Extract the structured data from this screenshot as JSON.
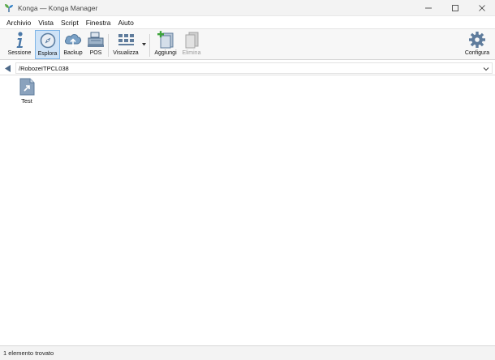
{
  "window": {
    "title": "Konga — Konga Manager",
    "controls": {
      "minimize": "minimize-icon",
      "maximize": "maximize-icon",
      "close": "close-icon"
    }
  },
  "menu": [
    "Archivio",
    "Vista",
    "Script",
    "Finestra",
    "Aiuto"
  ],
  "toolbar": {
    "sessione": "Sessione",
    "esplora": "Esplora",
    "backup": "Backup",
    "pos": "POS",
    "visualizza": "Visualizza",
    "aggiungi": "Aggiungi",
    "elimina": "Elimina",
    "configura": "Configura",
    "active": "Esplora",
    "accent": "#cfe3f7"
  },
  "path": {
    "value": "/RobozeITPCL038"
  },
  "items": [
    {
      "label": "Test",
      "icon": "document-link-icon"
    }
  ],
  "status": {
    "text": "1 elemento trovato"
  }
}
